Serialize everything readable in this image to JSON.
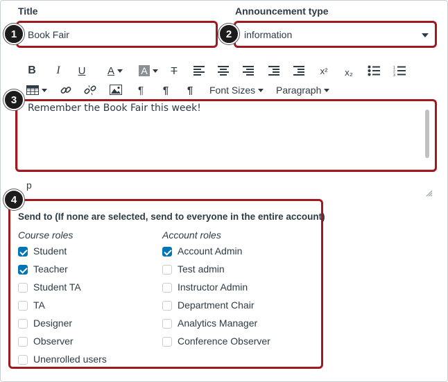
{
  "title": {
    "label": "Title",
    "value": "Book Fair"
  },
  "announcement_type": {
    "label": "Announcement type",
    "value": "information"
  },
  "toolbar": {
    "bold": "B",
    "italic": "I",
    "underline": "U",
    "font_color": "A",
    "background_color": "A",
    "clear_format": "T",
    "superscript": "x²",
    "subscript": "x₂",
    "font_sizes_label": "Font Sizes",
    "paragraph_label": "Paragraph"
  },
  "editor": {
    "content": "Remember the Book Fair this week!",
    "path": "p"
  },
  "send_to": {
    "heading": "Send to (If none are selected, send to everyone in the entire account)",
    "course_roles_label": "Course roles",
    "account_roles_label": "Account roles",
    "course_roles": [
      {
        "label": "Student",
        "checked": true
      },
      {
        "label": "Teacher",
        "checked": true
      },
      {
        "label": "Student TA",
        "checked": false
      },
      {
        "label": "TA",
        "checked": false
      },
      {
        "label": "Designer",
        "checked": false
      },
      {
        "label": "Observer",
        "checked": false
      },
      {
        "label": "Unenrolled users",
        "checked": false
      }
    ],
    "account_roles": [
      {
        "label": "Account Admin",
        "checked": true
      },
      {
        "label": "Test admin",
        "checked": false
      },
      {
        "label": "Instructor Admin",
        "checked": false
      },
      {
        "label": "Department Chair",
        "checked": false
      },
      {
        "label": "Analytics Manager",
        "checked": false
      },
      {
        "label": "Conference Observer",
        "checked": false
      }
    ]
  },
  "callouts": [
    "1",
    "2",
    "3",
    "4"
  ],
  "colors": {
    "highlight": "#a0191f",
    "checkbox": "#0374b5",
    "text": "#2d3b45"
  }
}
